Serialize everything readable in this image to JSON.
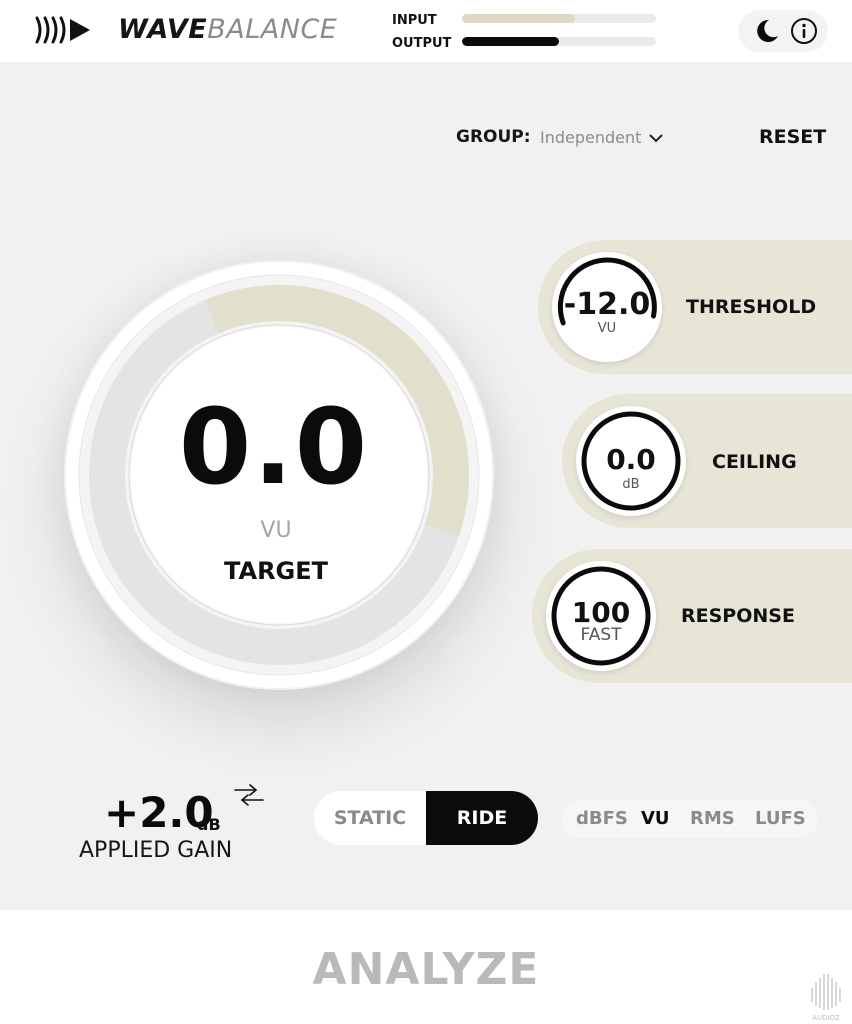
{
  "header": {
    "brand_bold": "WAVE",
    "brand_light": "BALANCE",
    "input_label": "INPUT",
    "output_label": "OUTPUT",
    "input_level": 0.58,
    "output_level": 0.5,
    "input_color": "#dcdac6",
    "output_color": "#0b0b0b"
  },
  "group": {
    "label": "GROUP:",
    "value": "Independent"
  },
  "reset_label": "RESET",
  "target": {
    "value": "0.0",
    "unit": "VU",
    "label": "TARGET"
  },
  "controls": {
    "threshold": {
      "value": "-12.0",
      "unit": "VU",
      "label": "THRESHOLD"
    },
    "ceiling": {
      "value": "0.0",
      "unit": "dB",
      "label": "CEILING"
    },
    "response": {
      "value": "100",
      "unit": "FAST",
      "label": "RESPONSE"
    }
  },
  "gain": {
    "value": "+2.0",
    "unit": "dB",
    "label": "APPLIED GAIN"
  },
  "mode": {
    "static_label": "STATIC",
    "ride_label": "RIDE",
    "active": "RIDE"
  },
  "units": {
    "options": [
      "dBFS",
      "VU",
      "RMS",
      "LUFS"
    ],
    "active": "VU"
  },
  "analyze_label": "ANALYZE",
  "watermark_text": "AUDIOZ",
  "colors": {
    "accent": "#e7e5d6",
    "dark": "#0b0b0b",
    "muted": "#8a8a8a"
  },
  "icons": [
    "wavebalance-logo-icon",
    "moon-icon",
    "info-icon",
    "chevron-down-icon",
    "swap-arrows-icon"
  ]
}
